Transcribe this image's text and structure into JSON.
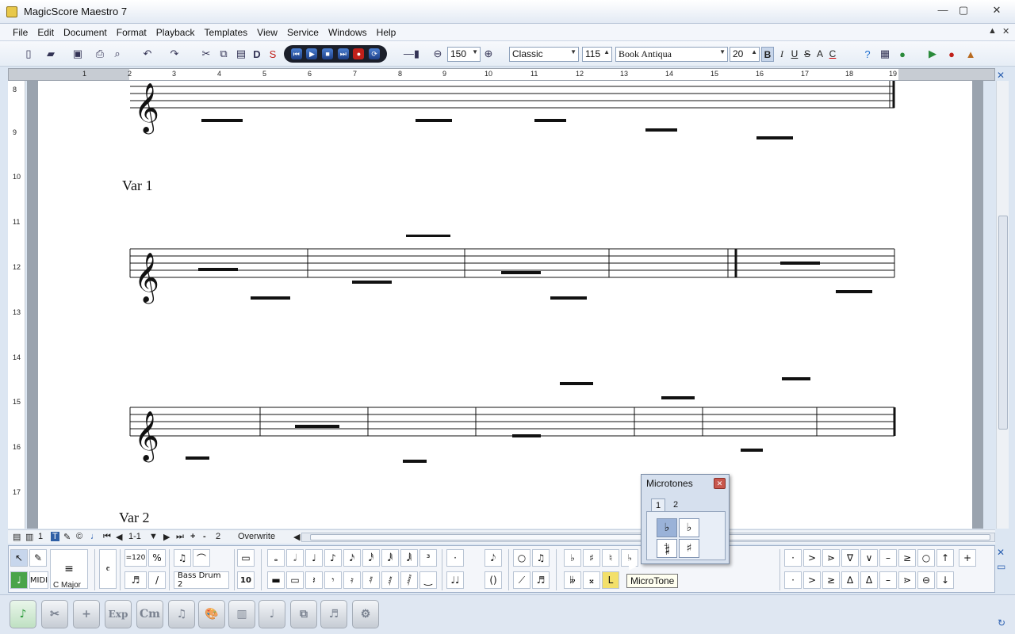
{
  "window": {
    "title": "MagicScore Maestro 7",
    "ghost_tabs": [
      "",
      "",
      "",
      "",
      "",
      "",
      "",
      "",
      ""
    ],
    "minimize": "—",
    "maximize": "▢",
    "close": "✕"
  },
  "menu": {
    "items": [
      "File",
      "Edit",
      "Document",
      "Format",
      "Playback",
      "Templates",
      "View",
      "Service",
      "Windows",
      "Help"
    ]
  },
  "toolbar": {
    "zoom_value": "150",
    "style_value": "Classic",
    "style_size": "115",
    "font_value": "Book Antiqua",
    "font_size": "20",
    "bold": "B",
    "italic": "I",
    "underline": "U",
    "strike": "S",
    "font_color": "A",
    "case": "C",
    "dash": "D"
  },
  "ruler": {
    "numbers": [
      "1",
      "2",
      "3",
      "4",
      "5",
      "6",
      "7",
      "8",
      "9",
      "10",
      "11",
      "12",
      "13",
      "14",
      "15",
      "16",
      "17",
      "18",
      "19"
    ]
  },
  "vruler": {
    "numbers": [
      "8",
      "9",
      "10",
      "11",
      "12",
      "13",
      "14",
      "15",
      "16",
      "17"
    ]
  },
  "score": {
    "var1_label": "Var 1",
    "var2_label": "Var 2"
  },
  "status": {
    "page_range": "1-1",
    "page_count": "2",
    "mode": "Overwrite",
    "buttons": [
      "+",
      "-"
    ]
  },
  "palette": {
    "instrument": "Bass Drum 2",
    "tempo": "=120",
    "key_label": "C Major",
    "midi": "MIDI",
    "ten": "10"
  },
  "microtones": {
    "title": "Microtones",
    "tabs": [
      "1",
      "2"
    ],
    "tooltip": "MicroTone"
  },
  "bottom_tools": [
    "♪",
    "✂",
    "+",
    "Exp",
    "Cm",
    "♫",
    "🎨",
    "▥",
    "♩",
    "⧉",
    "♬",
    "⚙"
  ],
  "colors": {
    "accent": "#2a5fb0",
    "titlebar": "#e3eaf4",
    "dialog": "#d6e0ee"
  }
}
